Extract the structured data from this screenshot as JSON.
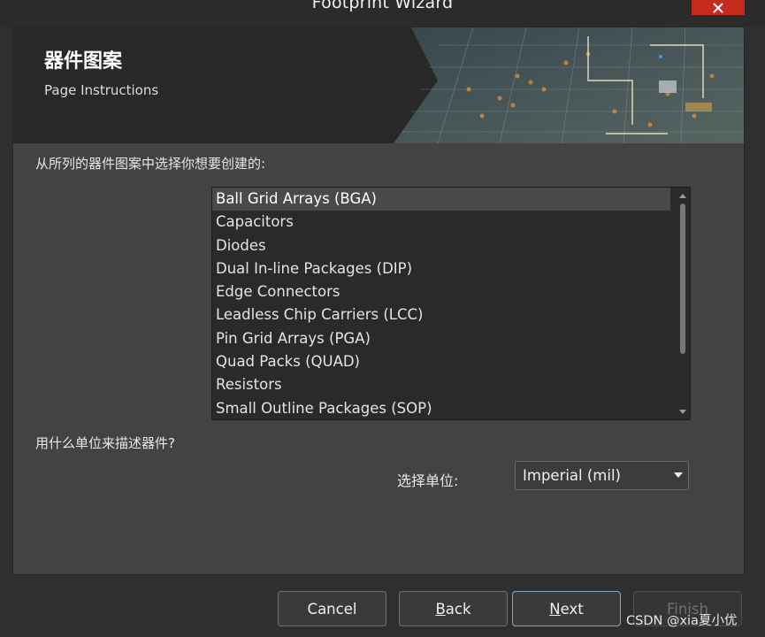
{
  "window": {
    "title": "Footprint Wizard",
    "close_icon": "close-icon"
  },
  "banner": {
    "heading": "器件图案",
    "subheading": "Page Instructions"
  },
  "main": {
    "pattern_prompt": "从所列的器件图案中选择你想要创建的:",
    "patterns": [
      "Ball Grid Arrays (BGA)",
      "Capacitors",
      "Diodes",
      "Dual In-line Packages (DIP)",
      "Edge Connectors",
      "Leadless Chip Carriers (LCC)",
      "Pin Grid Arrays (PGA)",
      "Quad Packs (QUAD)",
      "Resistors",
      "Small Outline Packages (SOP)"
    ],
    "selected_pattern": "Ball Grid Arrays (BGA)",
    "units_prompt": "用什么单位来描述器件?",
    "units_label": "选择单位:",
    "units_value": "Imperial (mil)"
  },
  "buttons": {
    "cancel": "Cancel",
    "back_mnemonic": "B",
    "back_rest": "ack",
    "next_mnemonic": "N",
    "next_rest": "ext",
    "finish": "Finish"
  },
  "watermark": "CSDN @xia夏小优"
}
